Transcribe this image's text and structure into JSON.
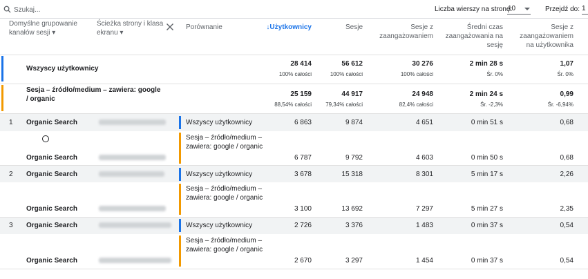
{
  "toolbar": {
    "search_placeholder": "Szukaj...",
    "rows_label": "Liczba wierszy na stronę:",
    "rows_value": "10",
    "goto_label": "Przejdź do:",
    "goto_value": "1"
  },
  "columns": {
    "dim1": "Domyślne grupowanie kanałów sesji",
    "dim2": "Ścieżka strony i klasa ekranu",
    "compare": "Porównanie",
    "users": "Użytkownicy",
    "sessions": "Sesje",
    "engaged": "Sesje z zaangażowaniem",
    "avg_time": "Średni czas zaangażowania na sesję",
    "engaged_per_user": "Sesje z zaangażowaniem na użytkownika"
  },
  "totals": [
    {
      "label": "Wszyscy użytkownicy",
      "users": "28 414",
      "users_sub": "100% całości",
      "sessions": "56 612",
      "sessions_sub": "100% całości",
      "engaged": "30 276",
      "engaged_sub": "100% całości",
      "avg_time": "2 min 28 s",
      "avg_time_sub": "Śr. 0%",
      "per_user": "1,07",
      "per_user_sub": "Śr. 0%"
    },
    {
      "label": "Sesja – źródło/medium – zawiera: google / organic",
      "users": "25 159",
      "users_sub": "88,54% całości",
      "sessions": "44 917",
      "sessions_sub": "79,34% całości",
      "engaged": "24 948",
      "engaged_sub": "82,4% całości",
      "avg_time": "2 min 24 s",
      "avg_time_sub": "Śr. -2,3%",
      "per_user": "0,99",
      "per_user_sub": "Śr. -6,94%"
    }
  ],
  "rows": [
    {
      "index": "1",
      "channel": "Organic Search",
      "sub": [
        {
          "segment": "Wszyscy użytkownicy",
          "users": "6 863",
          "sessions": "9 874",
          "engaged": "4 651",
          "avg_time": "0 min 51 s",
          "per_user": "0,68"
        },
        {
          "channel": "Organic Search",
          "segment": "Sesja – źródło/medium – zawiera: google / organic",
          "users": "6 787",
          "sessions": "9 792",
          "engaged": "4 603",
          "avg_time": "0 min 50 s",
          "per_user": "0,68"
        }
      ]
    },
    {
      "index": "2",
      "channel": "Organic Search",
      "sub": [
        {
          "segment": "Wszyscy użytkownicy",
          "users": "3 678",
          "sessions": "15 318",
          "engaged": "8 301",
          "avg_time": "5 min 17 s",
          "per_user": "2,26"
        },
        {
          "channel": "Organic Search",
          "segment": "Sesja – źródło/medium – zawiera: google / organic",
          "users": "3 100",
          "sessions": "13 692",
          "engaged": "7 297",
          "avg_time": "5 min 27 s",
          "per_user": "2,35"
        }
      ]
    },
    {
      "index": "3",
      "channel": "Organic Search",
      "sub": [
        {
          "segment": "Wszyscy użytkownicy",
          "users": "2 726",
          "sessions": "3 376",
          "engaged": "1 483",
          "avg_time": "0 min 37 s",
          "per_user": "0,54"
        },
        {
          "channel": "Organic Search",
          "segment": "Sesja – źródło/medium – zawiera: google / organic",
          "users": "2 670",
          "sessions": "3 297",
          "engaged": "1 454",
          "avg_time": "0 min 37 s",
          "per_user": "0,54"
        }
      ]
    }
  ],
  "colors": {
    "accent": "#1a73e8",
    "segment_all": "#1a73e8",
    "segment_google": "#f29900",
    "band": "#f1f3f4"
  }
}
